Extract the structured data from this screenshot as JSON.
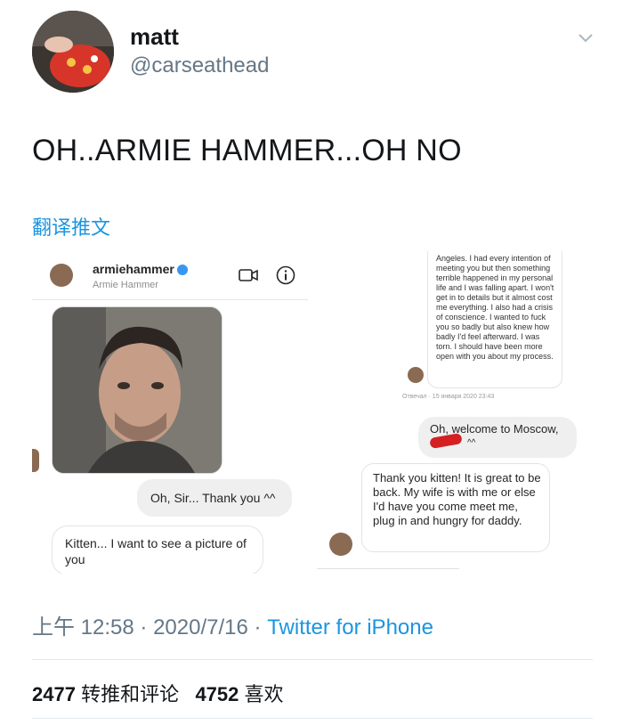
{
  "user": {
    "name": "matt",
    "handle": "@carseathead"
  },
  "tweet": {
    "text": "OH..ARMIE HAMMER...OH NO",
    "translate_label": "翻译推文"
  },
  "embedded": {
    "ig_username": "armiehammer",
    "ig_display": "Armie Hammer",
    "left_messages": [
      "Oh, Sir... Thank you ^^",
      "Kitten... I want to see a picture of you"
    ],
    "right_top_text": "Angeles. I had every intention of meeting you but then something terrible happened in my personal life and I was falling apart. I won't get in to details but it almost cost me everything. I also had a crisis of conscience. I wanted to fuck you so badly but also knew how badly I'd feel afterward. I was torn. I should have been more open with you about my process.",
    "right_timestamp": "Отвечал · 15 января 2020 23:43",
    "right_gray_message": "Oh, welcome to Moscow,",
    "right_gray_suffix": "^^",
    "right_reply": "Thank you kitten! It is great to be back. My wife is with me or else I'd have you come meet me, plug in and hungry for daddy."
  },
  "meta": {
    "time": "上午 12:58",
    "date": "2020/7/16",
    "dot": "·",
    "source": "Twitter for iPhone"
  },
  "stats": {
    "retweets_count": "2477",
    "retweets_label": "转推和评论",
    "likes_count": "4752",
    "likes_label": "喜欢"
  },
  "colors": {
    "link": "#1b95e0",
    "muted": "#657786",
    "text": "#14171a"
  },
  "icons": [
    "chevron-down-icon",
    "video-call-icon",
    "info-icon",
    "verified-badge-icon"
  ]
}
